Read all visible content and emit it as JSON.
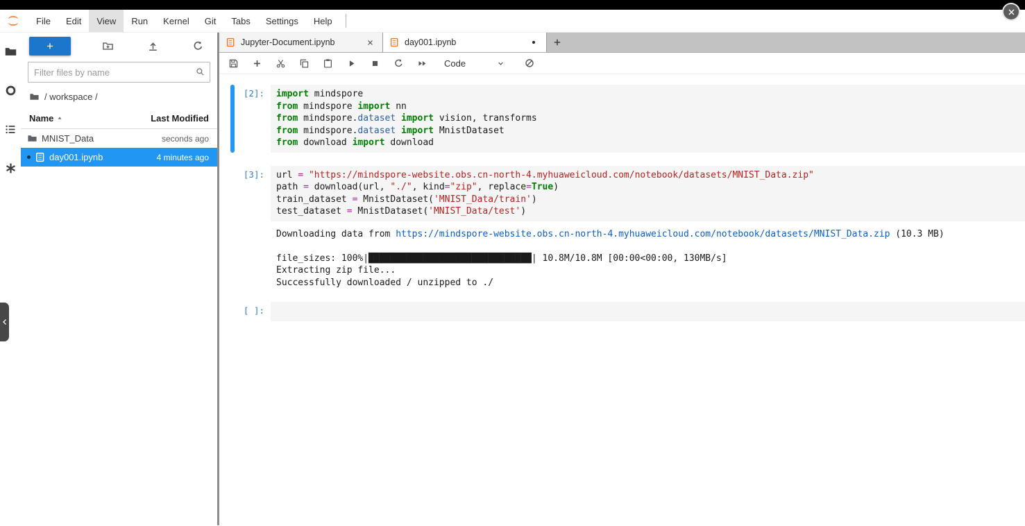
{
  "window": {
    "close_button": "close"
  },
  "menu_bar": {
    "active_item": "View",
    "items": [
      {
        "label": "File"
      },
      {
        "label": "Edit"
      },
      {
        "label": "View"
      },
      {
        "label": "Run"
      },
      {
        "label": "Kernel"
      },
      {
        "label": "Git"
      },
      {
        "label": "Tabs"
      },
      {
        "label": "Settings"
      },
      {
        "label": "Help"
      }
    ]
  },
  "activity_bar": {
    "items": [
      {
        "name": "file-browser-tab",
        "icon": "folder"
      },
      {
        "name": "running-sessions-tab",
        "icon": "circle-bold"
      },
      {
        "name": "table-of-contents-tab",
        "icon": "list"
      },
      {
        "name": "extension-manager-tab",
        "icon": "asterisk"
      }
    ]
  },
  "file_browser": {
    "toolbar": {
      "new_launcher_label": "+",
      "buttons": [
        {
          "name": "new-folder-button",
          "icon": "new-folder"
        },
        {
          "name": "upload-files-button",
          "icon": "upload"
        },
        {
          "name": "refresh-file-list-button",
          "icon": "refresh"
        }
      ]
    },
    "filter": {
      "placeholder": "Filter files by name"
    },
    "breadcrumb": {
      "path": "/ workspace /"
    },
    "listing": {
      "columns": [
        {
          "label": "Name",
          "sort": "ascending"
        },
        {
          "label": "Last Modified"
        }
      ],
      "files": [
        {
          "name": "MNIST_Data",
          "modified": "seconds ago",
          "icon": "folder",
          "selected": false,
          "open_indicator": false
        },
        {
          "name": "day001.ipynb",
          "modified": "4 minutes ago",
          "icon": "notebook",
          "selected": true,
          "open_indicator": true
        }
      ]
    }
  },
  "tab_bar": {
    "tabs": [
      {
        "label": "Jupyter-Document.ipynb",
        "active": false,
        "dirty": false
      },
      {
        "label": "day001.ipynb",
        "active": true,
        "dirty": true
      }
    ]
  },
  "notebook_toolbar": {
    "buttons": [
      {
        "name": "save-notebook-button",
        "icon": "save"
      },
      {
        "name": "insert-cell-button",
        "icon": "plus"
      },
      {
        "name": "cut-cells-button",
        "icon": "cut"
      },
      {
        "name": "copy-cells-button",
        "icon": "copy"
      },
      {
        "name": "paste-cells-button",
        "icon": "paste"
      },
      {
        "name": "run-cell-button",
        "icon": "run"
      },
      {
        "name": "interrupt-kernel-button",
        "icon": "stop"
      },
      {
        "name": "restart-kernel-button",
        "icon": "refresh"
      },
      {
        "name": "restart-run-all-button",
        "icon": "fast-forward"
      }
    ],
    "cell_type_dropdown": {
      "value": "Code"
    },
    "kernel_status": {
      "icon": "slashed-circle"
    }
  },
  "notebook": {
    "cells": [
      {
        "prompt": "[2]:",
        "active": true,
        "source": [
          [
            [
              "k",
              "import"
            ],
            [
              "p",
              " mindspore"
            ]
          ],
          [
            [
              "k",
              "from"
            ],
            [
              "p",
              " mindspore "
            ],
            [
              "k",
              "import"
            ],
            [
              "p",
              " nn"
            ]
          ],
          [
            [
              "k",
              "from"
            ],
            [
              "p",
              " mindspore."
            ],
            [
              "m",
              "dataset"
            ],
            [
              "p",
              " "
            ],
            [
              "k",
              "import"
            ],
            [
              "p",
              " vision, transforms"
            ]
          ],
          [
            [
              "k",
              "from"
            ],
            [
              "p",
              " mindspore."
            ],
            [
              "m",
              "dataset"
            ],
            [
              "p",
              " "
            ],
            [
              "k",
              "import"
            ],
            [
              "p",
              " MnistDataset"
            ]
          ],
          [
            [
              "k",
              "from"
            ],
            [
              "p",
              " download "
            ],
            [
              "k",
              "import"
            ],
            [
              "p",
              " download"
            ]
          ]
        ],
        "outputs": []
      },
      {
        "prompt": "[3]:",
        "active": false,
        "source": [
          [
            [
              "p",
              "url "
            ],
            [
              "o",
              "="
            ],
            [
              "p",
              " "
            ],
            [
              "s",
              "\"https://mindspore-website.obs.cn-north-4.myhuaweicloud.com/notebook/datasets/MNIST_Data.zip\""
            ]
          ],
          [
            [
              "p",
              "path "
            ],
            [
              "o",
              "="
            ],
            [
              "p",
              " download(url, "
            ],
            [
              "s",
              "\"./\""
            ],
            [
              "p",
              ", kind"
            ],
            [
              "o",
              "="
            ],
            [
              "s",
              "\"zip\""
            ],
            [
              "p",
              ", replace"
            ],
            [
              "o",
              "="
            ],
            [
              "k",
              "True"
            ],
            [
              "p",
              ")"
            ]
          ],
          [
            [
              "p",
              "train_dataset "
            ],
            [
              "o",
              "="
            ],
            [
              "p",
              " MnistDataset("
            ],
            [
              "s",
              "'MNIST_Data/train'"
            ],
            [
              "p",
              ")"
            ]
          ],
          [
            [
              "p",
              "test_dataset "
            ],
            [
              "o",
              "="
            ],
            [
              "p",
              " MnistDataset("
            ],
            [
              "s",
              "'MNIST_Data/test'"
            ],
            [
              "p",
              ")"
            ]
          ]
        ],
        "outputs": [
          [
            [
              "p",
              "Downloading data from "
            ],
            [
              "u",
              "https://mindspore-website.obs.cn-north-4.myhuaweicloud.com/notebook/datasets/MNIST_Data.zip"
            ],
            [
              "p",
              " (10.3 MB)"
            ]
          ],
          [],
          [
            [
              "p",
              "file_sizes: 100%|██████████████████████████████| 10.8M/10.8M [00:00<00:00, 130MB/s]"
            ]
          ],
          [
            [
              "p",
              "Extracting zip file..."
            ]
          ],
          [
            [
              "p",
              "Successfully downloaded / unzipped to ./"
            ]
          ]
        ]
      },
      {
        "prompt": "[ ]:",
        "active": false,
        "source": [
          []
        ],
        "outputs": []
      }
    ]
  },
  "colors": {
    "accent_blue": "#2196f3",
    "launcher_button": "#1c76cb",
    "selected_row": "#2196f3",
    "active_cell_bar": "#2196f3",
    "keyword_green": "#008000",
    "string_red": "#ba2121",
    "operator_purple": "#a626a4",
    "module_blue": "#2b5fa8",
    "link_blue": "#0b5fc4",
    "prompt_blue": "#307fc1",
    "notebook_icon_orange": "#f37726",
    "jupyter_logo_orange": "#f37626",
    "tabbar_background": "#c2c2c2"
  }
}
